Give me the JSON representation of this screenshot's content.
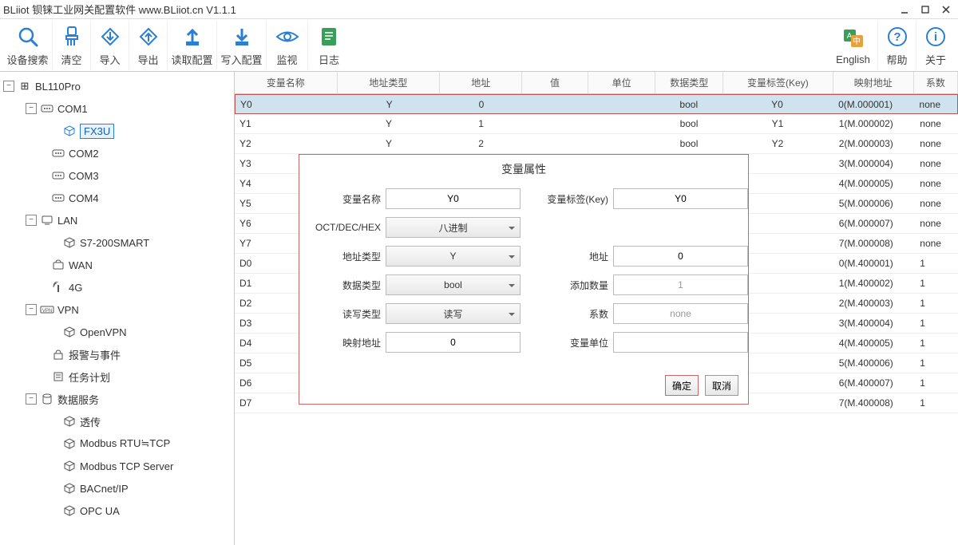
{
  "title": "BLiiot  钡铼工业网关配置软件 www.BLiiot.cn V1.1.1",
  "toolbar": {
    "search": "设备搜索",
    "clear": "清空",
    "import": "导入",
    "export": "导出",
    "read": "读取配置",
    "write": "写入配置",
    "monitor": "监视",
    "log": "日志",
    "english": "English",
    "help": "帮助",
    "about": "关于"
  },
  "tree": {
    "root": "BL110Pro",
    "com1": "COM1",
    "fx3u": "FX3U",
    "com2": "COM2",
    "com3": "COM3",
    "com4": "COM4",
    "lan": "LAN",
    "s7": "S7-200SMART",
    "wan": "WAN",
    "g4": "4G",
    "vpn": "VPN",
    "openvpn": "OpenVPN",
    "alarm": "报警与事件",
    "task": "任务计划",
    "dataservice": "数据服务",
    "pass": "透传",
    "mrtu": "Modbus RTU≒TCP",
    "mtcp": "Modbus TCP Server",
    "bacnet": "BACnet/IP",
    "opcua": "OPC UA"
  },
  "columns": [
    "变量名称",
    "地址类型",
    "地址",
    "值",
    "单位",
    "数据类型",
    "变量标签(Key)",
    "映射地址",
    "系数"
  ],
  "rows": [
    {
      "n": "Y0",
      "t": "Y",
      "a": "0",
      "v": "",
      "u": "",
      "d": "bool",
      "k": "Y0",
      "m": "0(M.000001)",
      "f": "none",
      "sel": true
    },
    {
      "n": "Y1",
      "t": "Y",
      "a": "1",
      "v": "",
      "u": "",
      "d": "bool",
      "k": "Y1",
      "m": "1(M.000002)",
      "f": "none"
    },
    {
      "n": "Y2",
      "t": "Y",
      "a": "2",
      "v": "",
      "u": "",
      "d": "bool",
      "k": "Y2",
      "m": "2(M.000003)",
      "f": "none"
    },
    {
      "n": "Y3",
      "t": "",
      "a": "",
      "v": "",
      "u": "",
      "d": "",
      "k": "",
      "m": "3(M.000004)",
      "f": "none"
    },
    {
      "n": "Y4",
      "t": "",
      "a": "",
      "v": "",
      "u": "",
      "d": "",
      "k": "",
      "m": "4(M.000005)",
      "f": "none"
    },
    {
      "n": "Y5",
      "t": "",
      "a": "",
      "v": "",
      "u": "",
      "d": "",
      "k": "",
      "m": "5(M.000006)",
      "f": "none"
    },
    {
      "n": "Y6",
      "t": "",
      "a": "",
      "v": "",
      "u": "",
      "d": "",
      "k": "",
      "m": "6(M.000007)",
      "f": "none"
    },
    {
      "n": "Y7",
      "t": "",
      "a": "",
      "v": "",
      "u": "",
      "d": "",
      "k": "",
      "m": "7(M.000008)",
      "f": "none"
    },
    {
      "n": "D0",
      "t": "",
      "a": "",
      "v": "",
      "u": "",
      "d": "",
      "k": "",
      "m": "0(M.400001)",
      "f": "1"
    },
    {
      "n": "D1",
      "t": "",
      "a": "",
      "v": "",
      "u": "",
      "d": "",
      "k": "",
      "m": "1(M.400002)",
      "f": "1"
    },
    {
      "n": "D2",
      "t": "",
      "a": "",
      "v": "",
      "u": "",
      "d": "",
      "k": "",
      "m": "2(M.400003)",
      "f": "1"
    },
    {
      "n": "D3",
      "t": "",
      "a": "",
      "v": "",
      "u": "",
      "d": "",
      "k": "",
      "m": "3(M.400004)",
      "f": "1"
    },
    {
      "n": "D4",
      "t": "",
      "a": "",
      "v": "",
      "u": "",
      "d": "",
      "k": "",
      "m": "4(M.400005)",
      "f": "1"
    },
    {
      "n": "D5",
      "t": "",
      "a": "",
      "v": "",
      "u": "",
      "d": "",
      "k": "",
      "m": "5(M.400006)",
      "f": "1"
    },
    {
      "n": "D6",
      "t": "",
      "a": "",
      "v": "",
      "u": "",
      "d": "",
      "k": "",
      "m": "6(M.400007)",
      "f": "1"
    },
    {
      "n": "D7",
      "t": "",
      "a": "",
      "v": "",
      "u": "",
      "d": "",
      "k": "",
      "m": "7(M.400008)",
      "f": "1"
    }
  ],
  "dialog": {
    "title": "变量属性",
    "labels": {
      "name": "变量名称",
      "odh": "OCT/DEC/HEX",
      "addrtype": "地址类型",
      "datatype": "数据类型",
      "rwtype": "读写类型",
      "mapaddr": "映射地址",
      "key": "变量标签(Key)",
      "addr": "地址",
      "addqty": "添加数量",
      "factor": "系数",
      "unit": "变量单位"
    },
    "values": {
      "name": "Y0",
      "odh": "八进制",
      "addrtype": "Y",
      "datatype": "bool",
      "rwtype": "读写",
      "mapaddr": "0",
      "key": "Y0",
      "addr": "0",
      "addqty": "1",
      "factor": "none",
      "unit": ""
    },
    "ok": "确定",
    "cancel": "取消"
  }
}
